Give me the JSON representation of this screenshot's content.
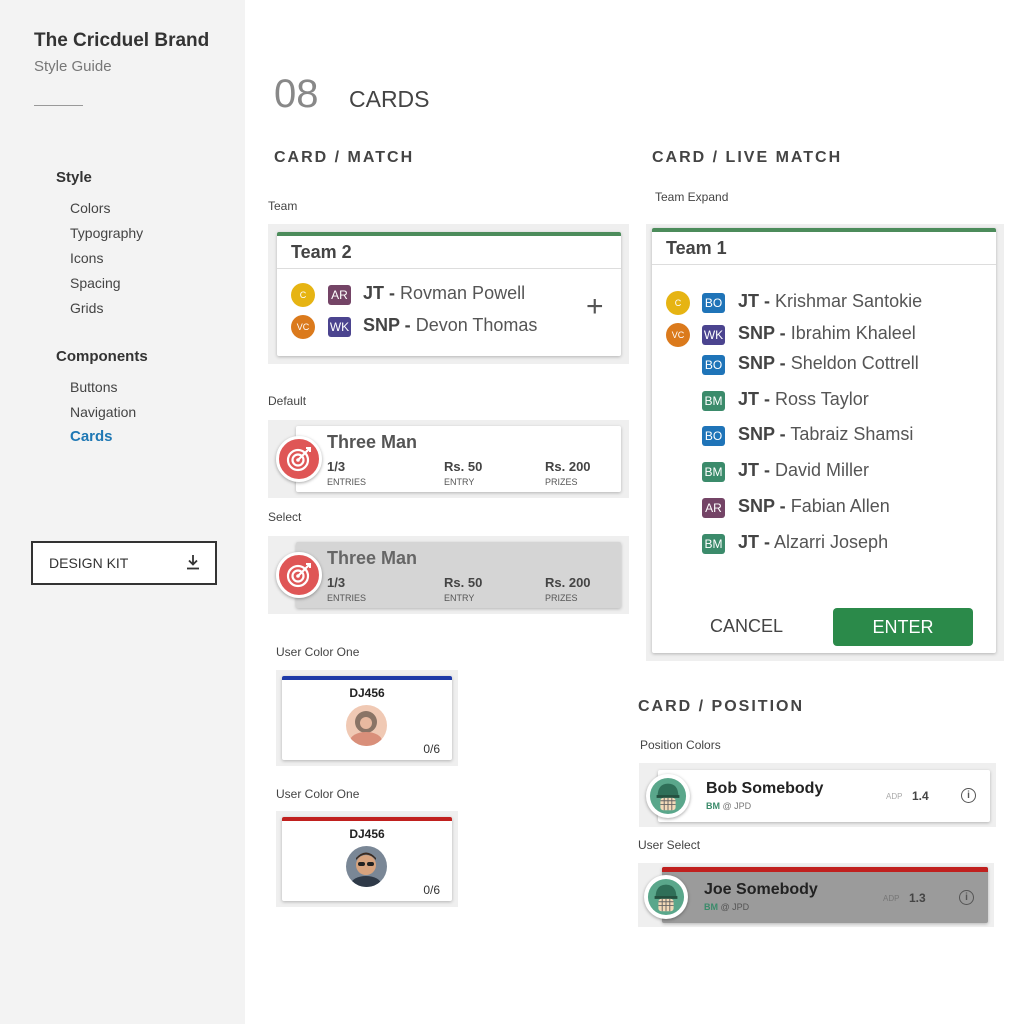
{
  "sidebar": {
    "brand": "The Cricduel Brand",
    "subtitle": "Style Guide",
    "style_heading": "Style",
    "style_items": [
      "Colors",
      "Typography",
      "Icons",
      "Spacing",
      "Grids"
    ],
    "components_heading": "Components",
    "component_items": [
      "Buttons",
      "Navigation",
      "Cards"
    ],
    "active_item": "Cards",
    "design_kit_label": "DESIGN KIT",
    "download_icon": "download-icon"
  },
  "page": {
    "number": "08",
    "title": "CARDS"
  },
  "card_match": {
    "section": "CARD / MATCH",
    "team_caption": "Team",
    "team_card": {
      "team": "Team 2",
      "players": [
        {
          "role": "C",
          "badge": "AR",
          "prefix": "JT -",
          "name": "Rovman Powell"
        },
        {
          "role": "VC",
          "badge": "WK",
          "prefix": "SNP -",
          "name": "Devon Thomas"
        }
      ],
      "add_symbol": "+"
    },
    "default_caption": "Default",
    "select_caption": "Select",
    "contest": {
      "title": "Three Man",
      "entries_value": "1/3",
      "entries_label": "ENTRIES",
      "entry_value": "Rs. 50",
      "entry_label": "ENTRY",
      "prizes_value": "Rs. 200",
      "prizes_label": "PRIZES"
    },
    "user_color_caption_1": "User Color One",
    "user_color_caption_2": "User Color One",
    "user_card_1": {
      "name": "DJ456",
      "count": "0/6",
      "accent": "#1e3aa8"
    },
    "user_card_2": {
      "name": "DJ456",
      "count": "0/6",
      "accent": "#c0201e"
    }
  },
  "card_live": {
    "section": "CARD / LIVE MATCH",
    "caption": "Team Expand",
    "team": "Team 1",
    "players": [
      {
        "role": "C",
        "badge": "BO",
        "prefix": "JT -",
        "name": "Krishmar Santokie"
      },
      {
        "role": "VC",
        "badge": "WK",
        "prefix": "SNP -",
        "name": "Ibrahim Khaleel"
      },
      {
        "role": "",
        "badge": "BO",
        "prefix": "SNP -",
        "name": "Sheldon Cottrell"
      },
      {
        "role": "",
        "badge": "BM",
        "prefix": "JT -",
        "name": "Ross Taylor"
      },
      {
        "role": "",
        "badge": "BO",
        "prefix": "SNP -",
        "name": "Tabraiz Shamsi"
      },
      {
        "role": "",
        "badge": "BM",
        "prefix": "JT -",
        "name": "David Miller"
      },
      {
        "role": "",
        "badge": "AR",
        "prefix": "SNP -",
        "name": "Fabian Allen"
      },
      {
        "role": "",
        "badge": "BM",
        "prefix": "JT -",
        "name": "Alzarri Joseph"
      }
    ],
    "cancel_label": "CANCEL",
    "enter_label": "ENTER"
  },
  "card_position": {
    "section": "CARD / POSITION",
    "caption_colors": "Position Colors",
    "caption_select": "User Select",
    "cards": [
      {
        "name": "Bob Somebody",
        "role": "BM",
        "team": "@ JPD",
        "adp_label": "ADP",
        "adp": "1.4"
      },
      {
        "name": "Joe Somebody",
        "role": "BM",
        "team": "@ JPD",
        "adp_label": "ADP",
        "adp": "1.3"
      }
    ]
  },
  "colors": {
    "green": "#4c8c5b",
    "enter_green": "#2b8a4a",
    "active_blue": "#1f78b4",
    "target_red": "#df5656",
    "select_red": "#c0201e",
    "user_blue": "#1e3aa8"
  }
}
